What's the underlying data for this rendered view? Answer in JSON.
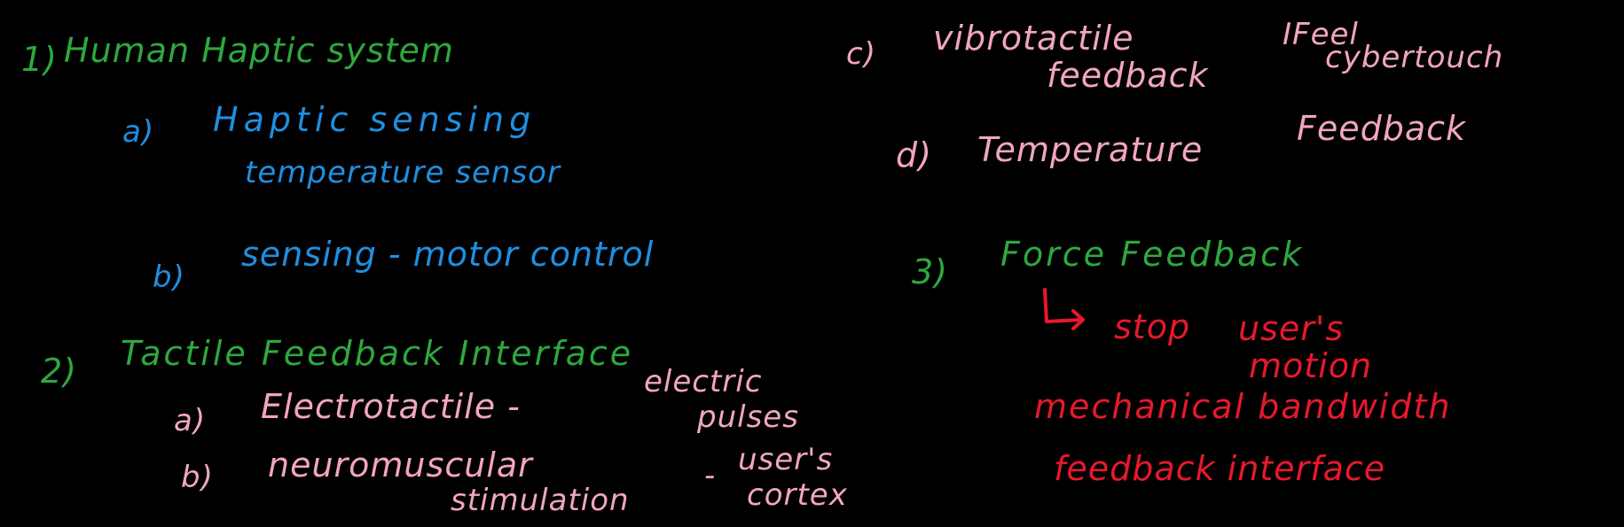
{
  "colors": {
    "background": "#000000",
    "green": "#2ea83f",
    "blue": "#1f8fe0",
    "pink": "#f2a6bd",
    "red": "#e8182e"
  },
  "sections": {
    "s1": {
      "number": "1)",
      "title": "Human Haptic system",
      "a_marker": "a)",
      "a_text": "Haptic sensing",
      "a_sub": "temperature sensor",
      "b_marker": "b)",
      "b_text": "sensing - motor control"
    },
    "s2": {
      "number": "2)",
      "title": "Tactile Feedback Interface",
      "a_marker": "a)",
      "a_text": "Electrotactile -",
      "a_note_line1": "electric",
      "a_note_line2": "pulses",
      "b_marker": "b)",
      "b_text": "neuromuscular",
      "b_sub": "stimulation",
      "b_dash": "-",
      "b_note_line1": "user's",
      "b_note_line2": "cortex",
      "c_marker": "c)",
      "c_text": "vibrotactile",
      "c_sub": "feedback",
      "c_note_line1": "IFeel",
      "c_note_line2": "cybertouch",
      "d_marker": "d)",
      "d_text": "Temperature",
      "d_text2": "Feedback"
    },
    "s3": {
      "number": "3)",
      "title": "Force Feedback",
      "arrow_icon": "return-arrow-icon",
      "note_stop": "stop",
      "note_user": "user's",
      "note_motion": "motion",
      "line2": "mechanical bandwidth",
      "line3": "feedback interface"
    }
  }
}
